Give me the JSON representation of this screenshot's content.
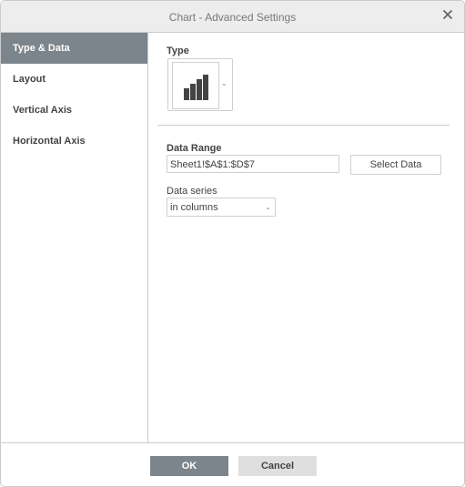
{
  "window": {
    "title": "Chart - Advanced Settings",
    "close_icon": "close-icon"
  },
  "sidebar": {
    "items": [
      {
        "label": "Type & Data",
        "active": true
      },
      {
        "label": "Layout",
        "active": false
      },
      {
        "label": "Vertical Axis",
        "active": false
      },
      {
        "label": "Horizontal Axis",
        "active": false
      }
    ]
  },
  "type_section": {
    "label": "Type",
    "selected_icon": "column-chart-icon",
    "caret": "⌄"
  },
  "data_range": {
    "label": "Data Range",
    "value": "Sheet1!$A$1:$D$7",
    "select_button": "Select Data"
  },
  "data_series": {
    "label": "Data series",
    "selected": "in columns",
    "caret": "⌄"
  },
  "footer": {
    "ok": "OK",
    "cancel": "Cancel"
  },
  "colors": {
    "accent": "#7d858c",
    "title_bar": "#ededed",
    "cancel_bg": "#dfdfdf",
    "border": "#cbcbcb"
  }
}
